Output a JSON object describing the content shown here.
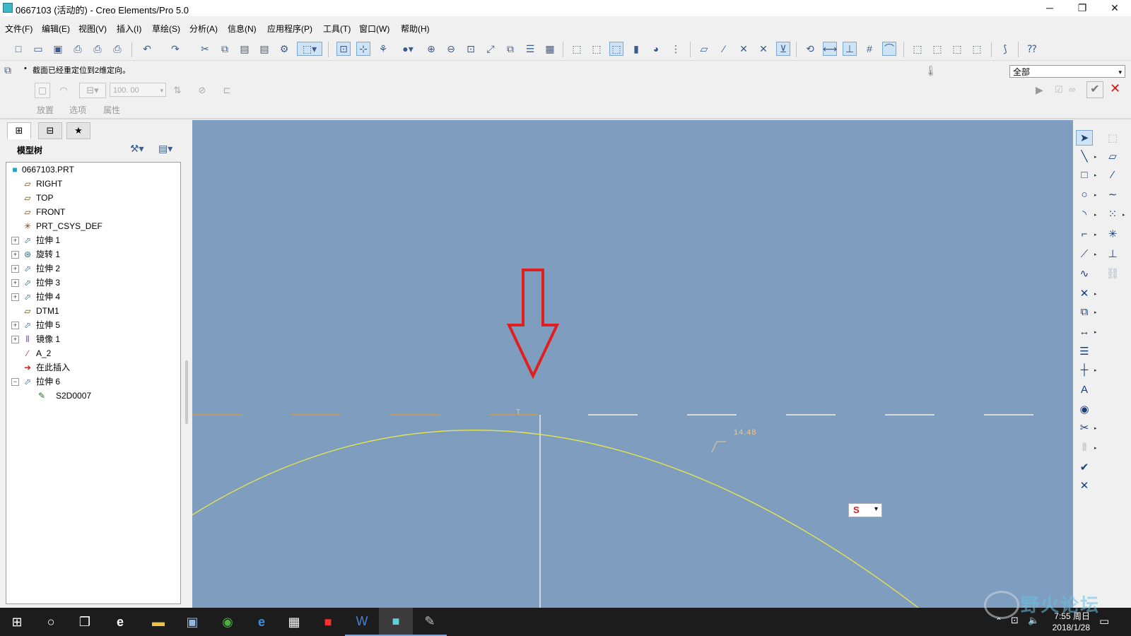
{
  "window": {
    "title": "0667103 (活动的) - Creo Elements/Pro 5.0",
    "minimize_glyph": "─",
    "restore_glyph": "❐",
    "close_glyph": "✕"
  },
  "menu": [
    "文件(F)",
    "编辑(E)",
    "视图(V)",
    "插入(I)",
    "草绘(S)",
    "分析(A)",
    "信息(N)",
    "应用程序(P)",
    "工具(T)",
    "窗口(W)",
    "帮助(H)"
  ],
  "message": {
    "text": "截面已经重定位到2维定向。",
    "filter_value": "全部"
  },
  "dashboard": {
    "labels": [
      "放置",
      "选项",
      "属性"
    ],
    "depth_value": "100. 00"
  },
  "model_tree": {
    "title": "模型树",
    "nodes": [
      {
        "label": "0667103.PRT",
        "icon": "part-icon"
      },
      {
        "label": "RIGHT",
        "icon": "datum-plane-icon"
      },
      {
        "label": "TOP",
        "icon": "datum-plane-icon"
      },
      {
        "label": "FRONT",
        "icon": "datum-plane-icon"
      },
      {
        "label": "PRT_CSYS_DEF",
        "icon": "csys-icon"
      },
      {
        "label": "拉伸 1",
        "icon": "extrude-icon",
        "expandable": true
      },
      {
        "label": "旋转 1",
        "icon": "revolve-icon",
        "expandable": true
      },
      {
        "label": "拉伸 2",
        "icon": "extrude-icon",
        "expandable": true
      },
      {
        "label": "拉伸 3",
        "icon": "extrude-icon",
        "expandable": true
      },
      {
        "label": "拉伸 4",
        "icon": "extrude-icon",
        "expandable": true
      },
      {
        "label": "DTM1",
        "icon": "datum-plane-icon"
      },
      {
        "label": "拉伸 5",
        "icon": "extrude-icon",
        "expandable": true
      },
      {
        "label": "镜像 1",
        "icon": "mirror-icon",
        "expandable": true
      },
      {
        "label": "A_2",
        "icon": "datum-axis-icon"
      },
      {
        "label": "在此插入",
        "icon": "insert-here-arrow-icon"
      },
      {
        "label": "拉伸 6",
        "icon": "extrude-icon",
        "expanded": true
      },
      {
        "label": "S2D0007",
        "icon": "sketch-icon",
        "child": true
      }
    ]
  },
  "sketch": {
    "dimension_value": "14.48",
    "constraint_marker": "T",
    "snap_icon_letter": "S"
  },
  "taskbar": {
    "time": "7:55 周日",
    "date": "2018/1/28"
  },
  "watermark": {
    "text": "野火论坛"
  },
  "colors": {
    "graphics_bg": "#7f9ebf",
    "sketch_curve": "#e8e84a",
    "dimension": "#e8c890",
    "centerline_orange": "#d99a3a",
    "arrow_red": "#e02020"
  }
}
